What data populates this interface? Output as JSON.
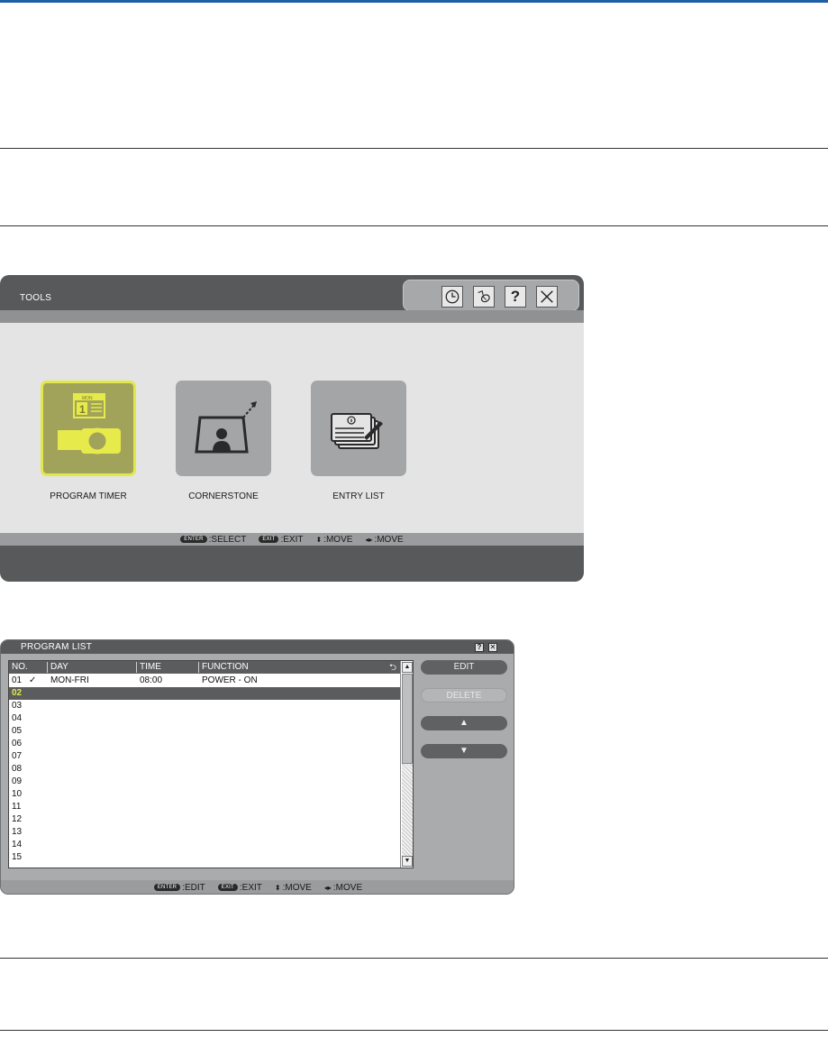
{
  "tools": {
    "title": "TOOLS",
    "icons": [
      "clock-icon",
      "mouse-icon",
      "help-icon",
      "close-icon"
    ],
    "help_glyph": "?",
    "items": [
      {
        "label": "PROGRAM TIMER",
        "icon": "program-timer-icon",
        "selected": true,
        "calendar_day": "MON",
        "calendar_date": "1"
      },
      {
        "label": "CORNERSTONE",
        "icon": "cornerstone-icon",
        "selected": false
      },
      {
        "label": "ENTRY LIST",
        "icon": "entry-list-icon",
        "selected": false
      }
    ],
    "guide": {
      "enter_key": "ENTER",
      "enter_action": ":SELECT",
      "exit_key": "EXIT",
      "exit_action": ":EXIT",
      "updown_glyph": "⬍",
      "updown_action": ":MOVE",
      "leftright_glyph": "◂▸",
      "leftright_action": ":MOVE"
    }
  },
  "program_list": {
    "title": "PROGRAM LIST",
    "title_help": "?",
    "title_close": "✕",
    "columns": {
      "no": "NO.",
      "day": "DAY",
      "time": "TIME",
      "function": "FUNCTION",
      "repeat_icon": "⮌"
    },
    "rows": [
      {
        "no": "01",
        "check": "✓",
        "day": "MON-FRI",
        "time": "08:00",
        "function": "POWER - ON"
      },
      {
        "no": "02",
        "check": "",
        "day": "",
        "time": "",
        "function": "",
        "selected": true
      },
      {
        "no": "03"
      },
      {
        "no": "04"
      },
      {
        "no": "05"
      },
      {
        "no": "06"
      },
      {
        "no": "07"
      },
      {
        "no": "08"
      },
      {
        "no": "09"
      },
      {
        "no": "10"
      },
      {
        "no": "11"
      },
      {
        "no": "12"
      },
      {
        "no": "13"
      },
      {
        "no": "14"
      },
      {
        "no": "15"
      }
    ],
    "buttons": {
      "edit": "EDIT",
      "delete": "DELETE",
      "up": "▲",
      "down": "▼"
    },
    "scroll": {
      "up": "▲",
      "down": "▼"
    },
    "guide": {
      "enter_key": "ENTER",
      "enter_action": ":EDIT",
      "exit_key": "EXIT",
      "exit_action": ":EXIT",
      "updown_glyph": "⬍",
      "updown_action": ":MOVE",
      "leftright_glyph": "◂▸",
      "leftright_action": ":MOVE"
    }
  },
  "colors": {
    "header_rule": "#1f5fa8",
    "selected_highlight": "#e0e84a",
    "window_dark": "#57595b",
    "window_body": "#e4e4e4"
  }
}
